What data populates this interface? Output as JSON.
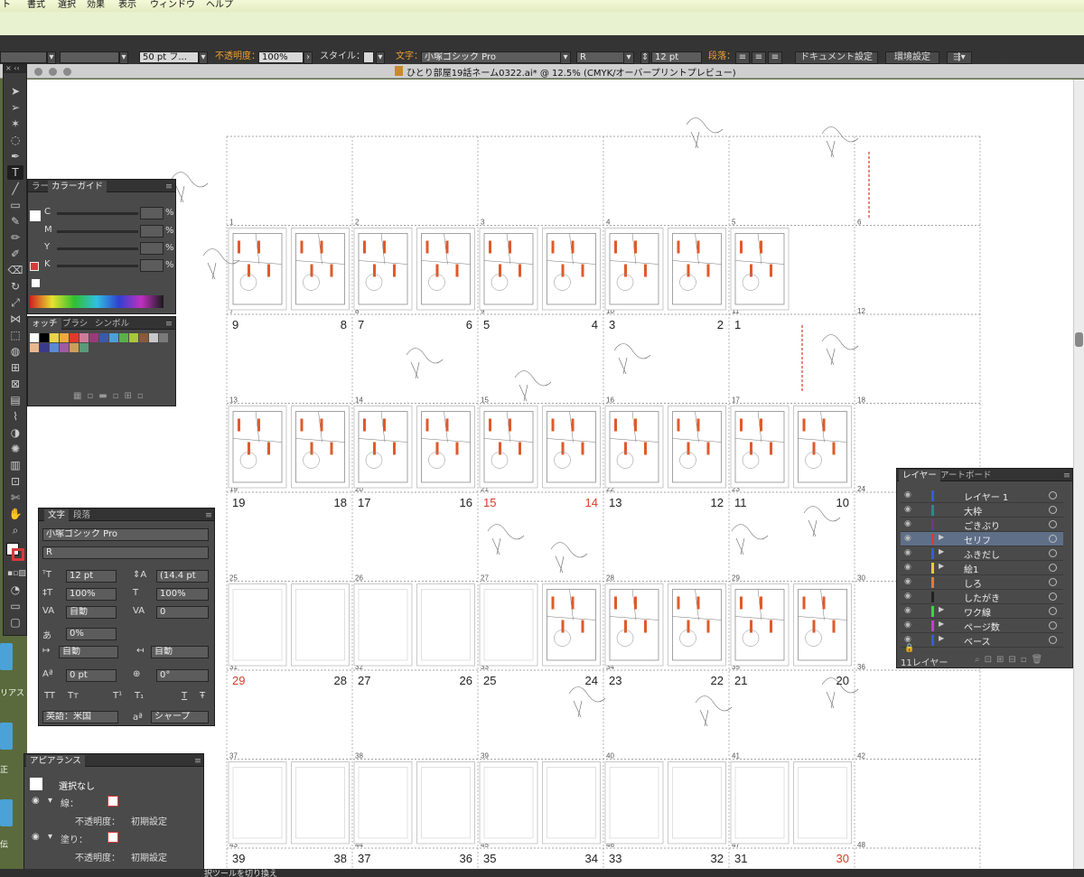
{
  "menubar": {
    "items": [
      "ト",
      "書式",
      "選択",
      "効果",
      "表示",
      "ウィンドウ",
      "ヘルプ"
    ]
  },
  "controlbar": {
    "stroke_value": "50 pt フ...",
    "opacity_label": "不透明度：",
    "opacity_value": "100%",
    "style_label": "スタイル：",
    "char_label": "文字：",
    "font_family": "小塚ゴシック Pro",
    "font_style": "R",
    "font_size": "12 pt",
    "paragraph_label": "段落：",
    "doc_settings": "ドキュメント設定",
    "preferences": "環境設定"
  },
  "document": {
    "title": "ひとり部屋19話ネーム0322.ai* @ 12.5% (CMYK/オーバープリントプレビュー)"
  },
  "colorguide_panel": {
    "tabs": [
      "ラー",
      "カラーガイド"
    ],
    "channels": [
      {
        "label": "C",
        "unit": "%"
      },
      {
        "label": "M",
        "unit": "%"
      },
      {
        "label": "Y",
        "unit": "%"
      },
      {
        "label": "K",
        "unit": "%"
      }
    ]
  },
  "swatch_panel": {
    "tabs": [
      "ォッチ",
      "ブラシ",
      "シンボル"
    ],
    "colors": [
      "#ffffff",
      "#000000",
      "#e8d34a",
      "#f2a93a",
      "#e23a2a",
      "#d07a9a",
      "#9a3a7a",
      "#3a5aa8",
      "#4aa0d8",
      "#5ab04a",
      "#a8c83a",
      "#8a5a3a",
      "#c8c8c8",
      "#7a7a7a",
      "#e8b890",
      "#3a3a8a",
      "#5a8ad0",
      "#a05aa0",
      "#c8a05a",
      "#5a9a7a"
    ]
  },
  "text_panel": {
    "tabs": [
      "文字",
      "段落"
    ],
    "font_family": "小塚ゴシック Pro",
    "font_style": "R",
    "size": "12 pt",
    "leading": "(14.4 pt",
    "vscale": "100%",
    "hscale": "100%",
    "kerning": "自動",
    "tracking": "0",
    "tsume": "0%",
    "aki_left": "自動",
    "aki_right": "自動",
    "baseline": "0 pt",
    "rotation": "0°",
    "language": "英語：米国",
    "antialias": "シャープ",
    "glyph_buttons": [
      "TT",
      "Tт",
      "T¹",
      "T₁",
      "T",
      "Ŧ"
    ]
  },
  "appearance_panel": {
    "tab": "アピアランス",
    "selection": "選択なし",
    "stroke_label": "線：",
    "fill_label": "塗り：",
    "opacity_label": "不透明度：",
    "opacity_value": "初期設定"
  },
  "layers_panel": {
    "tabs": [
      "レイヤー",
      "アートボード"
    ],
    "layers": [
      {
        "name": "レイヤー 1",
        "color": "#3a5ad8",
        "expand": false,
        "selected": false
      },
      {
        "name": "大枠",
        "color": "#2a8a8a",
        "expand": false,
        "selected": false
      },
      {
        "name": "ごきぶり",
        "color": "#6a3a8a",
        "expand": false,
        "selected": false
      },
      {
        "name": "セリフ",
        "color": "#d83a3a",
        "expand": true,
        "selected": true
      },
      {
        "name": "ふきだし",
        "color": "#3a5ad8",
        "expand": true,
        "selected": false
      },
      {
        "name": "絵1",
        "color": "#e8d030",
        "expand": true,
        "selected": false
      },
      {
        "name": "しろ",
        "color": "#e87a2a",
        "expand": false,
        "selected": false
      },
      {
        "name": "したがき",
        "color": "#222222",
        "expand": false,
        "selected": false
      },
      {
        "name": "ワク線",
        "color": "#3ad83a",
        "expand": true,
        "selected": false
      },
      {
        "name": "ページ数",
        "color": "#c83ad8",
        "expand": true,
        "selected": false
      },
      {
        "name": "ベース",
        "color": "#3a5ad8",
        "expand": true,
        "selected": false
      }
    ],
    "count": "11レイヤー"
  },
  "desktop": {
    "labels": [
      "リアス",
      "正",
      "伝"
    ]
  },
  "artboards": {
    "rows": [
      {
        "small": [
          "1",
          "2",
          "3",
          "4",
          "5",
          "6"
        ],
        "big": []
      },
      {
        "small": [
          "7",
          "8",
          "9",
          "10",
          "11",
          "12"
        ],
        "big": [
          "9",
          "8",
          "7",
          "6",
          "5",
          "4",
          "3",
          "2",
          "1"
        ]
      },
      {
        "small": [
          "13",
          "14",
          "15",
          "16",
          "17",
          "18"
        ],
        "big": []
      },
      {
        "small": [
          "19",
          "20",
          "21",
          "22",
          "23",
          "24"
        ],
        "big": [
          "19",
          "18",
          "17",
          "16",
          "15",
          "14",
          "13",
          "12",
          "11",
          "10"
        ]
      },
      {
        "small": [
          "25",
          "26",
          "27",
          "28",
          "29",
          "30"
        ],
        "big": []
      },
      {
        "small": [
          "31",
          "32",
          "33",
          "34",
          "35",
          "36"
        ],
        "big": [
          "29",
          "28",
          "27",
          "26",
          "25",
          "24",
          "23",
          "22",
          "21",
          "20"
        ]
      },
      {
        "small": [
          "37",
          "38",
          "39",
          "40",
          "41",
          "42"
        ],
        "big": []
      },
      {
        "small": [
          "43",
          "44",
          "45",
          "46",
          "47",
          "48"
        ],
        "big": [
          "39",
          "38",
          "37",
          "36",
          "35",
          "34",
          "33",
          "32",
          "31",
          "30"
        ]
      }
    ]
  },
  "status": {
    "text": "択ツールを切り換え"
  }
}
